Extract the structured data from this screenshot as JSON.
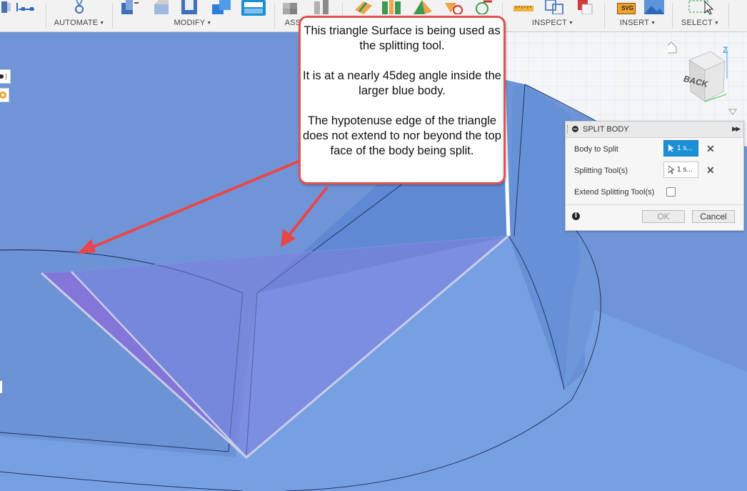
{
  "toolbar": {
    "groups": [
      {
        "label": "AUTOMATE"
      },
      {
        "label": "MODIFY"
      },
      {
        "label": "ASS"
      },
      {
        "label": "INSPECT"
      },
      {
        "label": "INSERT"
      },
      {
        "label": "SELECT"
      }
    ],
    "svg_badge": "SVG"
  },
  "callout": {
    "line1": "This triangle Surface is being used as the splitting tool.",
    "line2": "It is at a nearly 45deg angle inside the larger blue body.",
    "line3": "The hypotenuse edge of the triangle does not extend to nor beyond the top face of the body being split."
  },
  "split_panel": {
    "title": "SPLIT BODY",
    "body_label": "Body to Split",
    "body_value": "1 s...",
    "tool_label": "Splitting Tool(s)",
    "tool_value": "1 s...",
    "extend_label": "Extend Splitting Tool(s)",
    "extend_checked": false,
    "ok": "OK",
    "cancel": "Cancel"
  },
  "viewcube": {
    "face": "BACK",
    "axis_z": "Z"
  },
  "colors": {
    "body": "#6f95d8",
    "callout_border": "#e05252",
    "arrow": "#e8474a",
    "active_selection": "#1b8fd6"
  }
}
